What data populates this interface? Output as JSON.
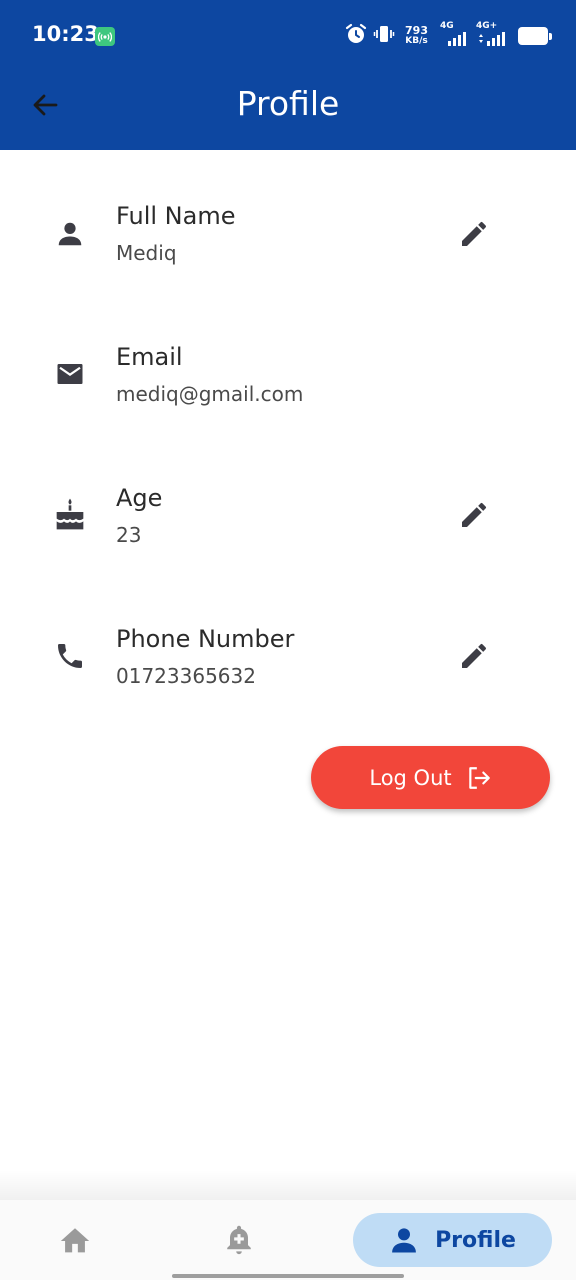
{
  "status_bar": {
    "time": "10:23",
    "speed_value": "793",
    "speed_unit": "KB/s",
    "sim1_network": "4G",
    "sim2_network": "4G+"
  },
  "header": {
    "title": "Profile",
    "back_icon": "arrow-back-icon"
  },
  "fields": [
    {
      "label": "Full Name",
      "value": "Mediq",
      "icon": "person-icon",
      "editable": true
    },
    {
      "label": "Email",
      "value": "mediq@gmail.com",
      "icon": "mail-icon",
      "editable": false
    },
    {
      "label": "Age",
      "value": "23",
      "icon": "cake-icon",
      "editable": true
    },
    {
      "label": "Phone Number",
      "value": "01723365632",
      "icon": "phone-icon",
      "editable": true
    }
  ],
  "logout": {
    "label": "Log Out",
    "icon": "logout-icon"
  },
  "bottom_nav": {
    "items": [
      {
        "icon": "home-icon",
        "active": false
      },
      {
        "icon": "add-alarm-icon",
        "active": false
      },
      {
        "icon": "person-icon",
        "label": "Profile",
        "active": true
      }
    ]
  },
  "colors": {
    "primary": "#0d47a1",
    "logout": "#f2463a",
    "active_pill": "#bfdcf5",
    "icon": "#3d3d45",
    "inactive_nav": "#9a9a9a"
  }
}
